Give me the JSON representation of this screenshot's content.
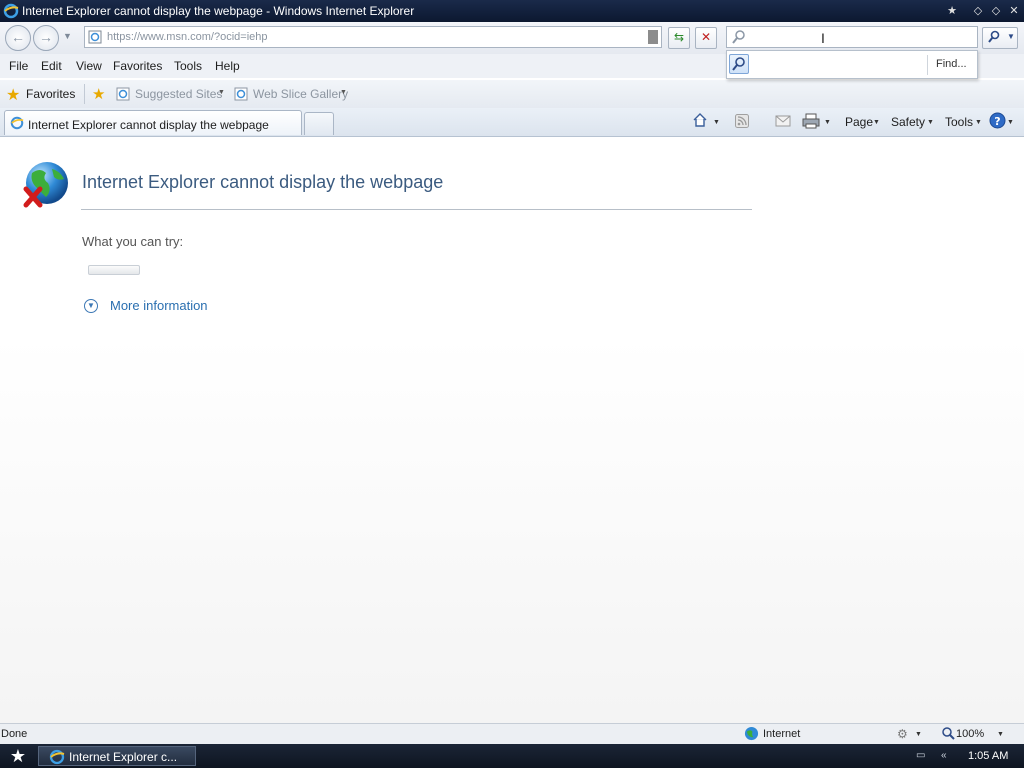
{
  "window": {
    "title": "Internet Explorer cannot display the webpage - Windows Internet Explorer"
  },
  "address_bar": {
    "url": "https://www.msn.com/?ocid=iehp"
  },
  "search": {
    "find_label": "Find..."
  },
  "menu": {
    "items": [
      {
        "label": "File"
      },
      {
        "label": "Edit"
      },
      {
        "label": "View"
      },
      {
        "label": "Favorites"
      },
      {
        "label": "Tools"
      },
      {
        "label": "Help"
      }
    ]
  },
  "favorites_bar": {
    "favorites_label": "Favorites",
    "suggested_sites": "Suggested Sites",
    "web_slice_gallery": "Web Slice Gallery"
  },
  "tabs": {
    "active_label": "Internet Explorer cannot display the webpage"
  },
  "command_bar": {
    "page": "Page",
    "safety": "Safety",
    "tools": "Tools"
  },
  "content": {
    "heading": "Internet Explorer cannot display the webpage",
    "try_label": "What you can try:",
    "more_info": "More information"
  },
  "status_bar": {
    "status": "Done",
    "zone": "Internet",
    "zoom": "100%"
  },
  "taskbar": {
    "task_label": "Internet Explorer c...",
    "clock": "1:05 AM"
  },
  "colors": {
    "link": "#2a6fb0",
    "heading": "#3b5b80",
    "titlebar": "#0c1830",
    "taskbar": "#0e1521"
  },
  "icons": {
    "app": "ie-logo-icon",
    "error": "globe-error-icon",
    "search": "magnifier-icon",
    "home": "home-icon",
    "feeds": "rss-icon",
    "mail": "mail-icon",
    "print": "printer-icon",
    "help": "help-icon"
  }
}
